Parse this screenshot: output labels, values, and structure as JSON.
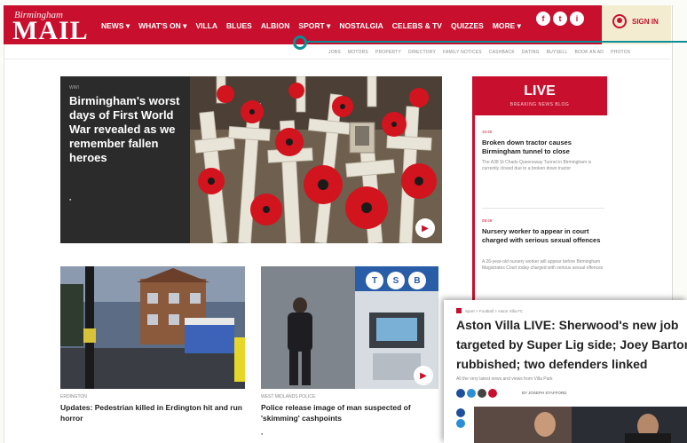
{
  "header": {
    "logo_small": "Birmingham",
    "logo_big": "MAIL",
    "nav": [
      "NEWS ▾",
      "WHAT'S ON ▾",
      "VILLA",
      "BLUES",
      "ALBION",
      "SPORT ▾",
      "NOSTALGIA",
      "CELEBS & TV",
      "QUIZZES",
      "MORE ▾"
    ],
    "social": [
      "f",
      "t",
      "i"
    ],
    "signin_label": "SIGN IN"
  },
  "subnav": [
    "JOBS",
    "MOTORS",
    "PROPERTY",
    "DIRECTORY",
    "FAMILY NOTICES",
    "CASHBACK",
    "DATING",
    "BUYSELL",
    "BOOK AN AD",
    "PHOTOS"
  ],
  "hero": {
    "tag": "WWI",
    "title": "Birmingham's worst days of First World War revealed as we remember fallen heroes",
    "camera": "▪"
  },
  "cards": [
    {
      "tag": "ERDINGTON",
      "title": "Updates: Pedestrian killed in Erdington hit and run horror"
    },
    {
      "tag": "WEST MIDLANDS POLICE",
      "title": "Police release image of man suspected of 'skimming' cashpoints",
      "sign": "TSB",
      "camera": "▪"
    }
  ],
  "live": {
    "title": "LIVE",
    "subtitle": "BREAKING NEWS BLOG",
    "items": [
      {
        "time": "10:40",
        "title": "Broken down tractor causes Birmingham tunnel to close",
        "body": "The A38 St Chads Queensway Tunnel in Birmingham is currently closed due to a broken down tractor"
      },
      {
        "time": "09:49",
        "title": "Nursery worker to appear in court charged with serious sexual offences",
        "body": "A 26-year-old nursery worker will appear before Birmingham Magistrates Court today charged with serious sexual offences"
      }
    ]
  },
  "overlay": {
    "crumb": "Sport > Football > Aston Villa FC",
    "line1": "Aston Villa LIVE: Sherwood's new job",
    "line2": "targeted by Super Lig side; Joey Barton",
    "line3": "rubbished; two defenders linked",
    "standfirst": "All the very latest news and views from Villa Park",
    "author": "BY JOSEPH STAFFORD"
  },
  "colors": {
    "brand": "#c8102e",
    "highlight": "#0a8f96"
  }
}
